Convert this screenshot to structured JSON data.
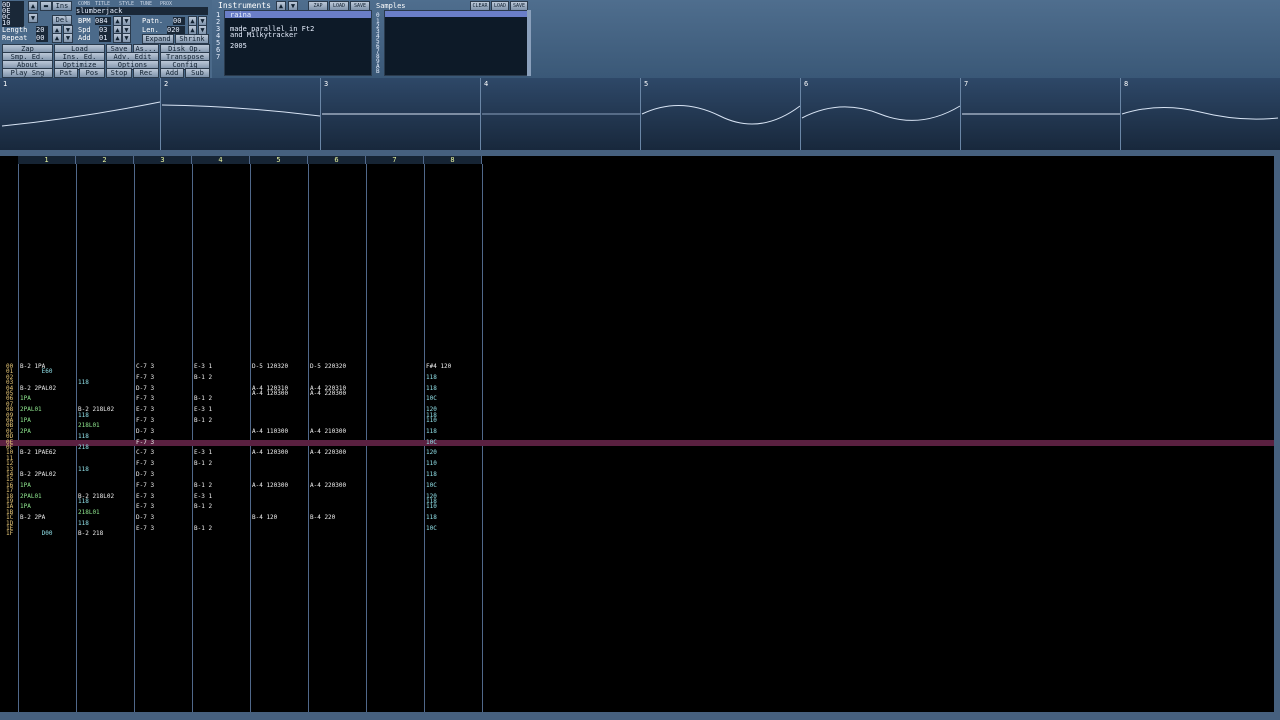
{
  "app": {
    "song_name": "slumberjack",
    "buttons_row_labels": [
      "Ins",
      "Del"
    ],
    "header_tabs": [
      "COMB",
      "TITLE",
      "STYLE",
      "TUNE",
      "PROX"
    ]
  },
  "song": {
    "length_label": "Length",
    "length_value": "20",
    "repeat_label": "Repeat",
    "repeat_value": "00",
    "bpm_label": "BPM",
    "bpm_value": "084",
    "spd_label": "Spd",
    "spd_value": "03",
    "add_label": "Add",
    "add_value": "01",
    "patn_label": "Patn.",
    "patn_value": "00",
    "len_label": "Len.",
    "len_value": "020",
    "expand_label": "Expand",
    "shrink_label": "Shrink",
    "pos_values": [
      "0D",
      "0E",
      "0C",
      "10"
    ]
  },
  "main_buttons": [
    [
      "Zap",
      "Load",
      "Save",
      "As...",
      "Disk Op."
    ],
    [
      "Smp. Ed.",
      "Ins. Ed.",
      "Adv. Edit",
      "Transpose"
    ],
    [
      "About",
      "Optimize",
      "Options",
      "Config"
    ],
    [
      "Play Sng",
      "Pat",
      "Pos",
      "Stop",
      "Rec",
      "Add",
      "Sub"
    ]
  ],
  "instruments": {
    "title": "Instruments",
    "lines": [
      "raina",
      "",
      "made parallel in Ft2",
      "and Milkytracker",
      "",
      "2005"
    ],
    "numbers": [
      "1",
      "2",
      "3",
      "4",
      "5",
      "6",
      "7"
    ],
    "buttons": [
      "ZAP",
      "LOAD",
      "SAVE"
    ]
  },
  "samples": {
    "title": "Samples",
    "numbers": [
      "0",
      "1",
      "2",
      "3",
      "4",
      "5",
      "6",
      "7",
      "8",
      "9",
      "A",
      "B"
    ],
    "buttons": [
      "CLEAR",
      "LOAD",
      "SAVE"
    ]
  },
  "wave_channels": [
    "1",
    "2",
    "3",
    "4",
    "5",
    "6",
    "7",
    "8"
  ],
  "pattern": {
    "channels": [
      "1",
      "2",
      "3",
      "4",
      "5",
      "6",
      "7",
      "8"
    ],
    "rows": [
      {
        "r": "00",
        "c": [
          "B-2 1PA",
          "",
          "C-7 3",
          "E-3 1",
          "D-5 120320",
          "D-5 220320",
          "",
          "F#4 120"
        ]
      },
      {
        "r": "01",
        "c": [
          "      E60",
          "",
          "",
          "",
          "",
          "",
          "",
          ""
        ]
      },
      {
        "r": "02",
        "c": [
          "",
          "",
          "F-7 3",
          "B-1 2",
          "",
          "",
          "",
          "118"
        ]
      },
      {
        "r": "03",
        "c": [
          "",
          "118",
          "",
          "",
          "",
          "",
          "",
          ""
        ]
      },
      {
        "r": "04",
        "c": [
          "B-2 2PAL02",
          "",
          "D-7 3",
          "",
          "A-4 120310",
          "A-4 220310",
          "",
          "118"
        ]
      },
      {
        "r": "05",
        "c": [
          "",
          "",
          "",
          "",
          "A-4 120300",
          "A-4 220300",
          "",
          ""
        ]
      },
      {
        "r": "06",
        "c": [
          "1PA",
          "",
          "F-7 3",
          "B-1 2",
          "",
          "",
          "",
          "10C"
        ]
      },
      {
        "r": "07",
        "c": [
          "",
          "",
          "",
          "",
          "",
          "",
          "",
          ""
        ]
      },
      {
        "r": "08",
        "c": [
          "2PAL01",
          "B-2 218L02",
          "E-7 3",
          "E-3 1",
          "",
          "",
          "",
          "120"
        ]
      },
      {
        "r": "09",
        "c": [
          "",
          "118",
          "",
          "",
          "",
          "",
          "",
          "118"
        ]
      },
      {
        "r": "0A",
        "c": [
          "1PA",
          "",
          "F-7 3",
          "B-1 2",
          "",
          "",
          "",
          "110"
        ]
      },
      {
        "r": "0B",
        "c": [
          "",
          "218L01",
          "",
          "",
          "",
          "",
          "",
          ""
        ]
      },
      {
        "r": "0C",
        "c": [
          "2PA",
          "",
          "D-7 3",
          "",
          "A-4 110300",
          "A-4 210300",
          "",
          "118"
        ]
      },
      {
        "r": "0D",
        "c": [
          "",
          "118",
          "",
          "",
          "",
          "",
          "",
          ""
        ]
      },
      {
        "r": "0E",
        "c": [
          "",
          "",
          "F-7 3",
          "",
          "",
          "",
          "",
          "10C"
        ]
      },
      {
        "r": "0F",
        "c": [
          "",
          "218",
          "",
          "",
          "",
          "",
          "",
          ""
        ]
      },
      {
        "r": "10",
        "c": [
          "B-2 1PAE62",
          "",
          "C-7 3",
          "E-3 1",
          "A-4 120300",
          "A-4 220300",
          "",
          "120"
        ]
      },
      {
        "r": "11",
        "c": [
          "",
          "",
          "",
          "",
          "",
          "",
          "",
          ""
        ]
      },
      {
        "r": "12",
        "c": [
          "",
          "",
          "F-7 3",
          "B-1 2",
          "",
          "",
          "",
          "110"
        ]
      },
      {
        "r": "13",
        "c": [
          "",
          "118",
          "",
          "",
          "",
          "",
          "",
          ""
        ]
      },
      {
        "r": "14",
        "c": [
          "B-2 2PAL02",
          "",
          "D-7 3",
          "",
          "",
          "",
          "",
          "118"
        ]
      },
      {
        "r": "15",
        "c": [
          "",
          "",
          "",
          "",
          "",
          "",
          "",
          ""
        ]
      },
      {
        "r": "16",
        "c": [
          "1PA",
          "",
          "F-7 3",
          "B-1 2",
          "A-4 120300",
          "A-4 220300",
          "",
          "10C"
        ]
      },
      {
        "r": "17",
        "c": [
          "",
          "",
          "",
          "",
          "",
          "",
          "",
          ""
        ]
      },
      {
        "r": "18",
        "c": [
          "2PAL01",
          "B-2 218L02",
          "E-7 3",
          "E-3 1",
          "",
          "",
          "",
          "120"
        ]
      },
      {
        "r": "19",
        "c": [
          "",
          "118",
          "",
          "",
          "",
          "",
          "",
          "118"
        ]
      },
      {
        "r": "1A",
        "c": [
          "1PA",
          "",
          "E-7 3",
          "B-1 2",
          "",
          "",
          "",
          "110"
        ]
      },
      {
        "r": "1B",
        "c": [
          "",
          "218L01",
          "",
          "",
          "",
          "",
          "",
          ""
        ]
      },
      {
        "r": "1C",
        "c": [
          "B-2 2PA",
          "",
          "D-7 3",
          "",
          "B-4 120",
          "B-4 220",
          "",
          "118"
        ]
      },
      {
        "r": "1D",
        "c": [
          "",
          "118",
          "",
          "",
          "",
          "",
          "",
          ""
        ]
      },
      {
        "r": "1E",
        "c": [
          "",
          "",
          "E-7 3",
          "B-1 2",
          "",
          "",
          "",
          "10C"
        ]
      },
      {
        "r": "1F",
        "c": [
          "      D00",
          "B-2 218",
          "",
          "",
          "",
          "",
          "",
          ""
        ]
      }
    ]
  }
}
